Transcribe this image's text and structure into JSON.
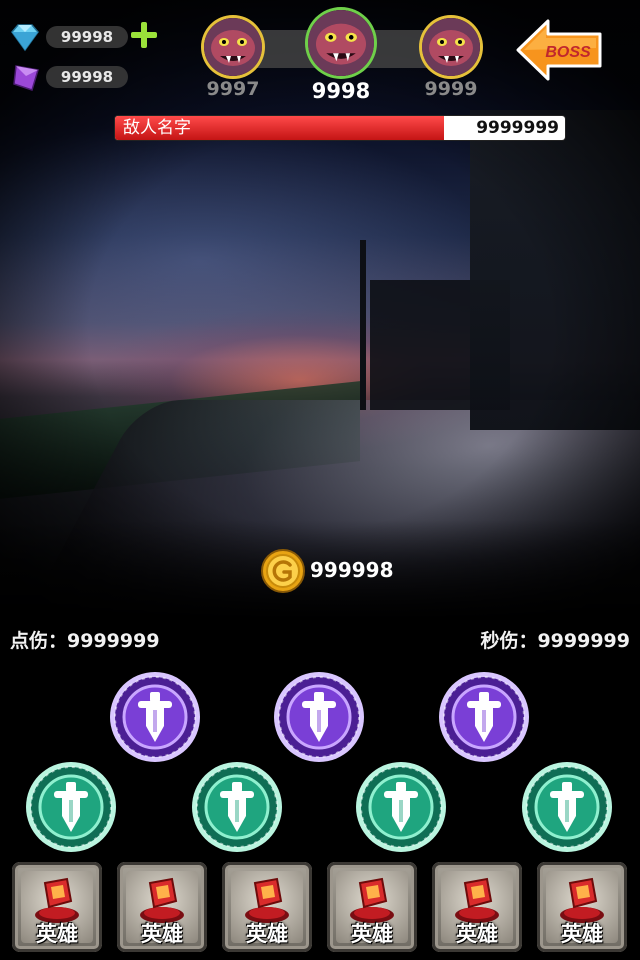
{
  "resources": {
    "diamond": {
      "value": "99998",
      "icon": "diamond-icon",
      "color": "#4fb8e6"
    },
    "crystal": {
      "value": "99998",
      "icon": "purple-crystal-icon",
      "color": "#8a3cc8"
    },
    "add_icon": "plus-icon"
  },
  "enemies": {
    "prev": {
      "number": "9997"
    },
    "current": {
      "number": "9998"
    },
    "next": {
      "number": "9999"
    }
  },
  "boss_button": {
    "label": "BOSS",
    "color": "#f7941d"
  },
  "enemy_hp": {
    "name": "敌人名字",
    "value": "9999999",
    "fill_fraction": 0.73
  },
  "gold": {
    "value": "999998"
  },
  "stats": {
    "tap_damage": "点伤：9999999",
    "dps": "秒伤：9999999"
  },
  "skills_purple": [
    "sword-skill-icon",
    "sword-skill-icon",
    "sword-skill-icon"
  ],
  "skills_green": [
    "sword-skill-icon",
    "sword-skill-icon",
    "sword-skill-icon",
    "sword-skill-icon"
  ],
  "heroes": [
    {
      "label": "英雄"
    },
    {
      "label": "英雄"
    },
    {
      "label": "英雄"
    },
    {
      "label": "英雄"
    },
    {
      "label": "英雄"
    },
    {
      "label": "英雄"
    }
  ]
}
